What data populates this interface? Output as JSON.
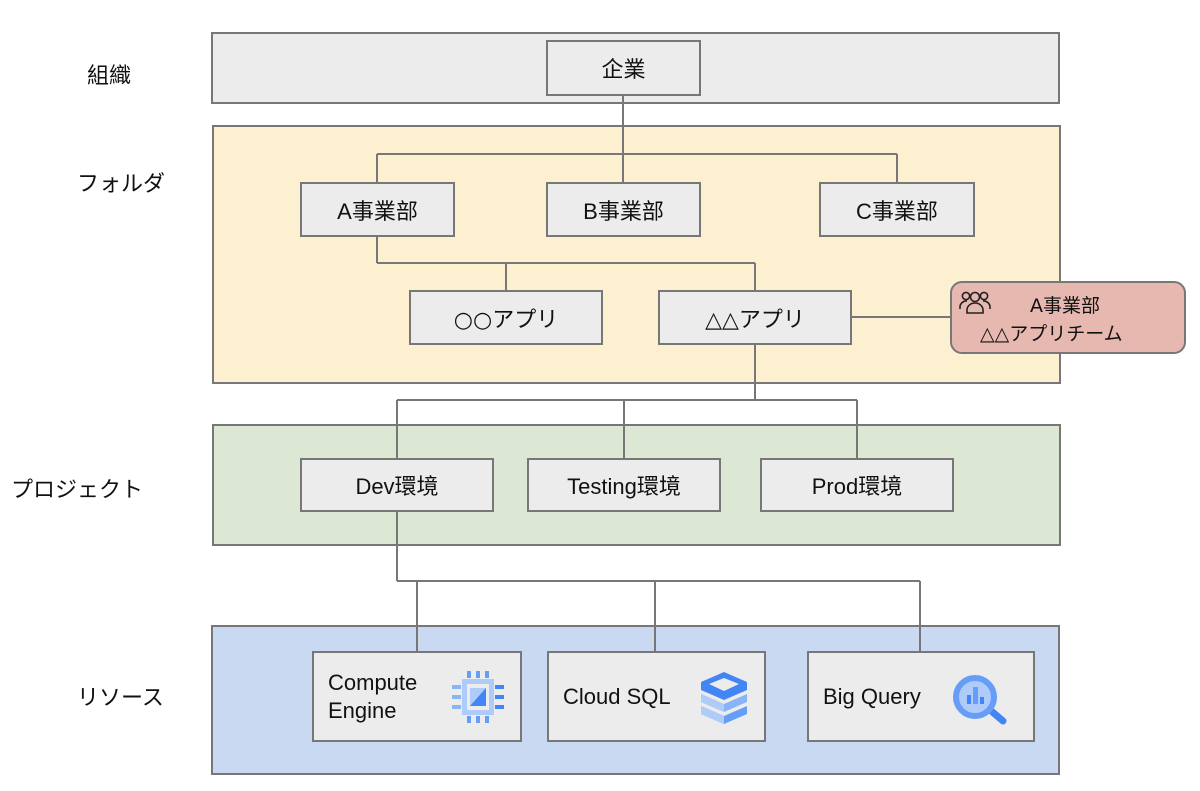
{
  "diagram": {
    "layers": [
      {
        "id": "org",
        "label": "組織"
      },
      {
        "id": "folder",
        "label": "フォルダ"
      },
      {
        "id": "project",
        "label": "プロジェクト"
      },
      {
        "id": "resource",
        "label": "リソース"
      }
    ],
    "organization": {
      "label": "企業"
    },
    "folders": {
      "divisions": [
        {
          "label": "A事業部"
        },
        {
          "label": "B事業部"
        },
        {
          "label": "C事業部"
        }
      ],
      "apps": [
        {
          "label": "○○アプリ"
        },
        {
          "label": "△△アプリ"
        }
      ]
    },
    "team": {
      "icon": "group-icon",
      "line1": "A事業部",
      "line2": "△△アプリチーム"
    },
    "projects": [
      {
        "label": "Dev環境"
      },
      {
        "label": "Testing環境"
      },
      {
        "label": "Prod環境"
      }
    ],
    "resources": [
      {
        "label_line1": "Compute",
        "label_line2": "Engine",
        "icon": "compute-engine-icon"
      },
      {
        "label": "Cloud SQL",
        "icon": "cloud-sql-icon"
      },
      {
        "label": "Big Query",
        "icon": "bigquery-icon"
      }
    ],
    "colors": {
      "org_panel": "#ececec",
      "folder_panel": "#fcf0d0",
      "project_panel": "#dce8d4",
      "resource_panel": "#c9d9f2",
      "team_box": "#e6b8af",
      "node": "#ececec",
      "border": "#777777",
      "gcp_blue": "#4285f4",
      "gcp_light_blue": "#aecbfa"
    }
  }
}
